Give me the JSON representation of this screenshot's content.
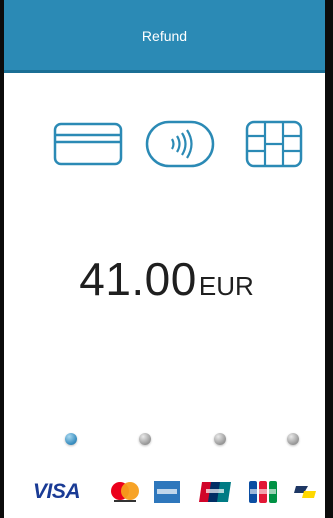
{
  "header": {
    "title": "Refund",
    "color": "#2b8ab5"
  },
  "payment_methods": [
    {
      "name": "card-swipe-icon"
    },
    {
      "name": "contactless-icon"
    },
    {
      "name": "chip-card-icon"
    }
  ],
  "amount": {
    "value": "41.00",
    "currency": "EUR"
  },
  "progress": {
    "steps": 4,
    "active_step": 1
  },
  "brands": {
    "visa": "VISA",
    "list": [
      "visa-logo",
      "mastercard-logo",
      "amex-logo",
      "unionpay-logo",
      "jcb-logo",
      "bancontact-logo"
    ]
  }
}
